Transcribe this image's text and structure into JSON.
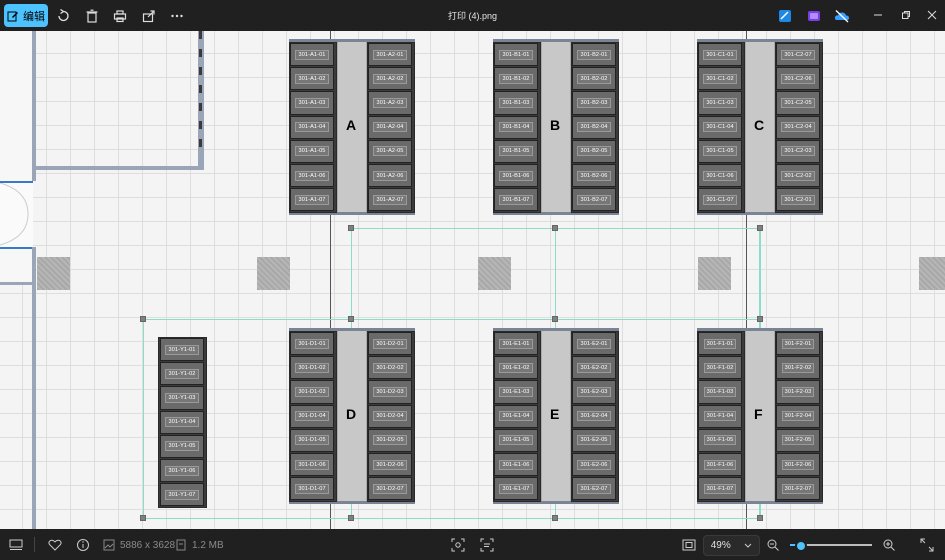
{
  "toolbar": {
    "edit_label": "编辑",
    "icons": [
      "edit-icon",
      "rotate-icon",
      "delete-icon",
      "print-icon",
      "share-icon",
      "more-icon"
    ],
    "title": "打印 (4).png",
    "right_icons": [
      "photos-edit-icon",
      "clipchamp-icon",
      "onedrive-off-icon"
    ]
  },
  "canvas": {
    "blocks": [
      {
        "letter": "A",
        "left": [
          "301-A1-01",
          "301-A1-02",
          "301-A1-03",
          "301-A1-04",
          "301-A1-05",
          "301-A1-06",
          "301-A1-07"
        ],
        "right": [
          "301-A2-01",
          "301-A2-02",
          "301-A2-03",
          "301-A2-04",
          "301-A2-05",
          "301-A2-06",
          "301-A2-07"
        ]
      },
      {
        "letter": "B",
        "left": [
          "301-B1-01",
          "301-B1-02",
          "301-B1-03",
          "301-B1-04",
          "301-B1-05",
          "301-B1-06",
          "301-B1-07"
        ],
        "right": [
          "301-B2-01",
          "301-B2-02",
          "301-B2-03",
          "301-B2-04",
          "301-B2-05",
          "301-B2-06",
          "301-B2-07"
        ]
      },
      {
        "letter": "C",
        "left": [
          "301-C1-01",
          "301-C1-02",
          "301-C1-03",
          "301-C1-04",
          "301-C1-05",
          "301-C1-06",
          "301-C1-07"
        ],
        "right": [
          "301-C2-07",
          "301-C2-06",
          "301-C2-05",
          "301-C2-04",
          "301-C2-03",
          "301-C2-02",
          "301-C2-01"
        ]
      },
      {
        "letter": "D",
        "left": [
          "301-D1-01",
          "301-D1-02",
          "301-D1-03",
          "301-D1-04",
          "301-D1-05",
          "301-D1-06",
          "301-D1-07"
        ],
        "right": [
          "301-D2-01",
          "301-D2-02",
          "301-D2-03",
          "301-D2-04",
          "301-D2-05",
          "301-D2-06",
          "301-D2-07"
        ]
      },
      {
        "letter": "E",
        "left": [
          "301-E1-01",
          "301-E1-02",
          "301-E1-03",
          "301-E1-04",
          "301-E1-05",
          "301-E1-06",
          "301-E1-07"
        ],
        "right": [
          "301-E2-01",
          "301-E2-02",
          "301-E2-03",
          "301-E2-04",
          "301-E2-05",
          "301-E2-06",
          "301-E2-07"
        ]
      },
      {
        "letter": "F",
        "left": [
          "301-F1-01",
          "301-F1-02",
          "301-F1-03",
          "301-F1-04",
          "301-F1-05",
          "301-F1-06",
          "301-F1-07"
        ],
        "right": [
          "301-F2-01",
          "301-F2-02",
          "301-F2-03",
          "301-F2-04",
          "301-F2-05",
          "301-F2-06",
          "301-F2-07"
        ]
      }
    ],
    "y_rack": [
      "301-Y1-01",
      "301-Y1-02",
      "301-Y1-03",
      "301-Y1-04",
      "301-Y1-05",
      "301-Y1-06",
      "301-Y1-07"
    ]
  },
  "statusbar": {
    "dimensions": "5886 x 3628",
    "file_size": "1.2 MB",
    "zoom": "49%",
    "zoom_fraction": 0.12,
    "accent": "#4cc2ff"
  }
}
